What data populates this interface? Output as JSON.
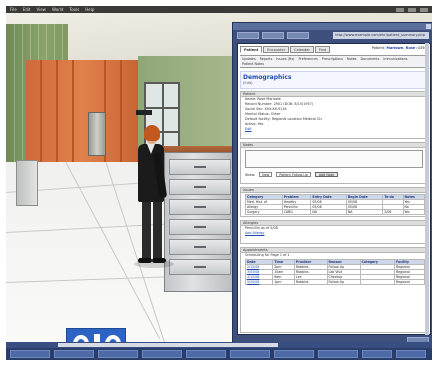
{
  "menubar": {
    "items": [
      "File",
      "Edit",
      "View",
      "World",
      "Tools",
      "Help"
    ]
  },
  "browser": {
    "url": "http://www.example.com/ehr/patient_summary.php",
    "buttons": [
      "Back",
      "Forward",
      "Reload",
      "Home",
      "Go"
    ]
  },
  "ehr": {
    "tabs": [
      "Patient",
      "Encounter",
      "Calendar",
      "Find"
    ],
    "patient_head_label": "Patient:",
    "patient_name": "Marlowe, Rose",
    "patient_id": "(4356)",
    "nav": [
      "Updates",
      "Reports",
      "Issues (Rx)",
      "Preferences",
      "Prescriptions",
      "Notes",
      "Documents",
      "Immunizations",
      "Patient Notes"
    ],
    "title": "Demographics",
    "title_sub": "(Edit)",
    "patient_section": "Patient",
    "patient_rows": [
      "Name: Rose Marlowe",
      "Record Number: 2901 (DOB: 8/15/1957)",
      "Social Sec: XXX-XX-9134",
      "Marital Status: Other",
      "Default facility: Regional Location Medical Ctr",
      "Active: Yes"
    ],
    "patient_link": "Edit",
    "notes_section": "Notes",
    "notes_show_label": "Show:",
    "notes_select": "New",
    "notes_to_select": "Patient Follow-Up",
    "notes_button": "Add Note",
    "issues_section": "Issues",
    "issues_headers": [
      "Category",
      "Problem",
      "Entry Date",
      "Begin Date",
      "To-do",
      "Notes"
    ],
    "issues_rows": [
      [
        "Med. Hist. of",
        "Healthy",
        "05/08",
        "05/08",
        "",
        "Yes"
      ],
      [
        "Allergy",
        "Penicillin",
        "05/08",
        "05/08",
        "",
        "No"
      ],
      [
        "Surgery",
        "CABG",
        "NA",
        "NA",
        "2/08",
        "Yes"
      ]
    ],
    "allergies_section": "Allergies",
    "allergies_row": "Penicillin as of 5/08",
    "allergies_link": "Add Allergy",
    "appointments_section": "Appointments",
    "appointments_sub": "Scheduling for Page 1 of 1",
    "appt_headers": [
      "Date",
      "Time",
      "Provider",
      "Reason",
      "Category",
      "Facility"
    ],
    "appt_rows": [
      [
        "2/15/08",
        "2pm",
        "Robbins",
        "Follow-Up",
        "",
        "Regional"
      ],
      [
        "3/03/08",
        "10am",
        "Robbins",
        "Lab Visit",
        "",
        "Regional"
      ],
      [
        "4/12/08",
        "9am",
        "Lee",
        "Checkup",
        "",
        "Regional"
      ],
      [
        "5/20/08",
        "1pm",
        "Robbins",
        "Follow-Up",
        "",
        "Regional"
      ]
    ]
  },
  "colors": {
    "floater_bg": "#3d4f7a",
    "link_blue": "#1d4bb0",
    "logo_blue": "#2d63c4"
  },
  "icons": [
    "close-icon",
    "logo-mark-icon"
  ]
}
